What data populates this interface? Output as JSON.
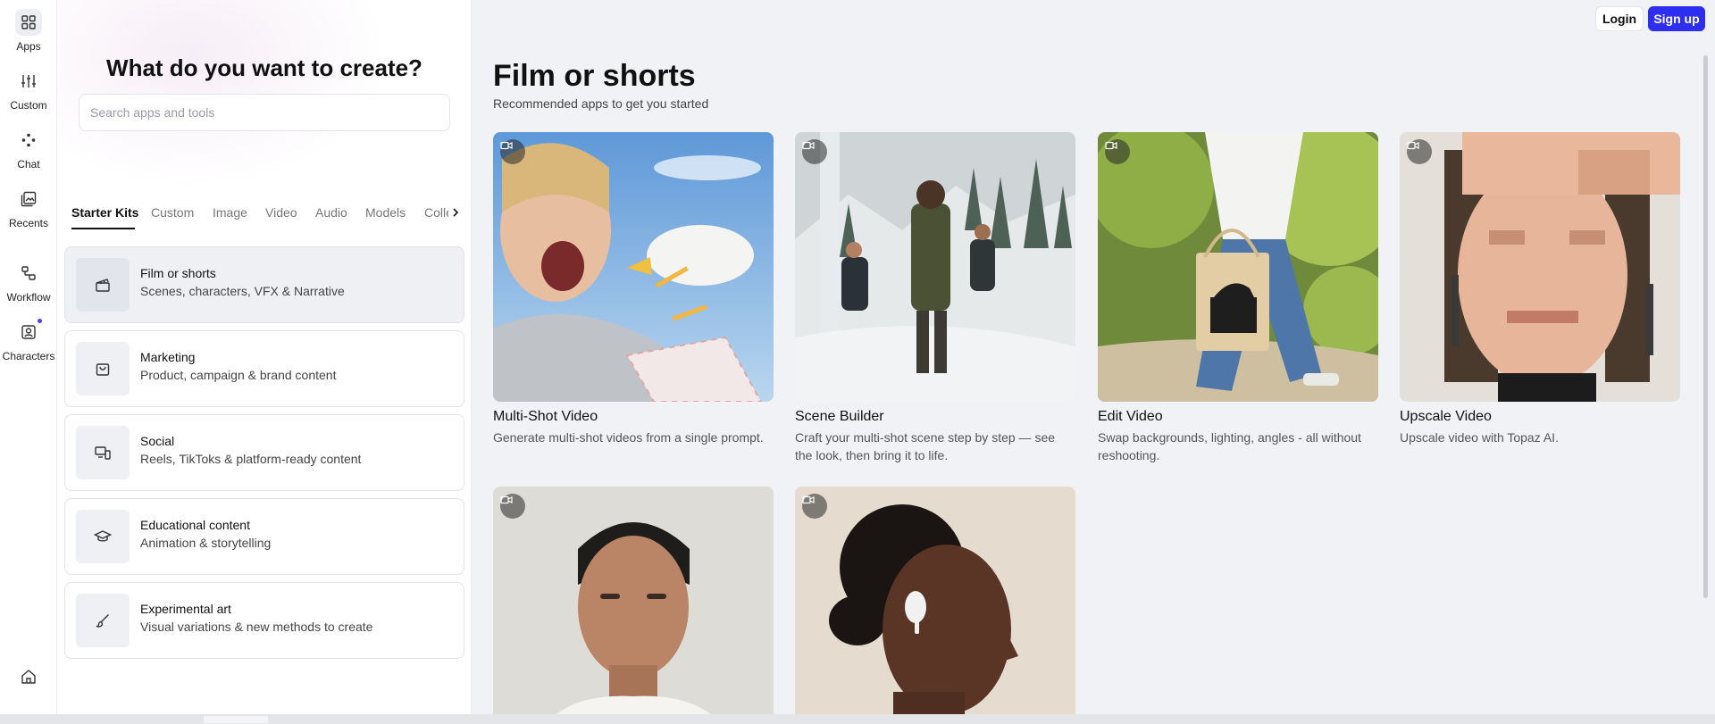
{
  "rail": {
    "items": [
      {
        "label": "Apps",
        "icon": "grid-icon"
      },
      {
        "label": "Custom",
        "icon": "sliders-icon"
      },
      {
        "label": "Chat",
        "icon": "chat-dots-icon"
      },
      {
        "label": "Recents",
        "icon": "image-stack-icon"
      },
      {
        "label": "Workflow",
        "icon": "workflow-icon"
      },
      {
        "label": "Characters",
        "icon": "character-icon"
      }
    ],
    "home_icon": "home-icon"
  },
  "panel": {
    "title": "What do you want to create?",
    "search_placeholder": "Search apps and tools",
    "tabs": [
      "Starter Kits",
      "Custom",
      "Image",
      "Video",
      "Audio",
      "Models",
      "Colle"
    ],
    "active_tab": "Starter Kits",
    "kits": [
      {
        "title": "Film or shorts",
        "subtitle": "Scenes, characters, VFX & Narrative",
        "icon": "clapperboard-icon"
      },
      {
        "title": "Marketing",
        "subtitle": "Product, campaign & brand content",
        "icon": "shopping-bag-icon"
      },
      {
        "title": "Social",
        "subtitle": "Reels, TikToks & platform-ready content",
        "icon": "devices-icon"
      },
      {
        "title": "Educational content",
        "subtitle": "Animation & storytelling",
        "icon": "graduation-cap-icon"
      },
      {
        "title": "Experimental art",
        "subtitle": "Visual variations & new methods to create",
        "icon": "brush-icon"
      }
    ]
  },
  "header": {
    "login_label": "Login",
    "signup_label": "Sign up",
    "accent_color": "#2e2ef0"
  },
  "main": {
    "title": "Film or shorts",
    "subtitle": "Recommended apps to get you started",
    "cards": [
      {
        "title": "Multi-Shot Video",
        "description": "Generate multi-shot videos from a single prompt."
      },
      {
        "title": "Scene Builder",
        "description": "Craft your multi-shot scene step by step — see the look, then bring it to life."
      },
      {
        "title": "Edit Video",
        "description": "Swap backgrounds, lighting, angles - all without reshooting."
      },
      {
        "title": "Upscale Video",
        "description": "Upscale video with Topaz AI."
      },
      {
        "title": "",
        "description": ""
      },
      {
        "title": "",
        "description": ""
      }
    ]
  }
}
